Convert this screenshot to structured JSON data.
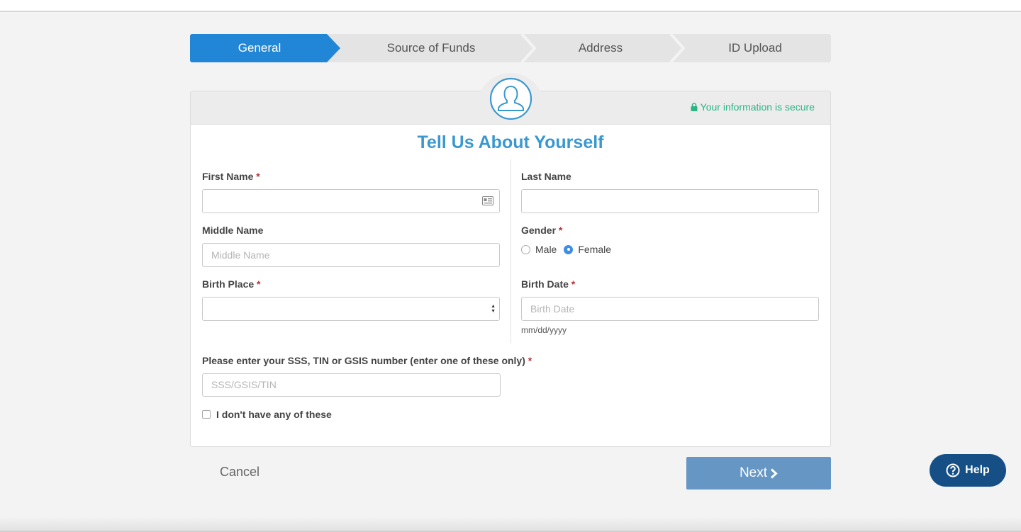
{
  "stepper": {
    "steps": [
      {
        "label": "General",
        "active": true
      },
      {
        "label": "Source of Funds",
        "active": false
      },
      {
        "label": "Address",
        "active": false
      },
      {
        "label": "ID Upload",
        "active": false
      }
    ]
  },
  "card": {
    "secure_text": "Your information is secure",
    "title": "Tell Us About Yourself"
  },
  "form": {
    "first_name": {
      "label": "First Name",
      "required_mark": "*",
      "value": ""
    },
    "last_name": {
      "label": "Last Name",
      "value": ""
    },
    "middle_name": {
      "label": "Middle Name",
      "placeholder": "Middle Name"
    },
    "gender": {
      "label": "Gender",
      "required_mark": "*",
      "options": [
        "Male",
        "Female"
      ],
      "selected": "Female"
    },
    "birth_place": {
      "label": "Birth Place",
      "required_mark": "*",
      "value": ""
    },
    "birth_date": {
      "label": "Birth Date",
      "required_mark": "*",
      "placeholder": "Birth Date",
      "hint": "mm/dd/yyyy"
    },
    "id_number": {
      "label": "Please enter your SSS, TIN or GSIS number (enter one of these only)",
      "required_mark": "*",
      "placeholder": "SSS/GSIS/TIN"
    },
    "no_id_checkbox": {
      "label": "I don't have any of these",
      "checked": false
    }
  },
  "actions": {
    "cancel_label": "Cancel",
    "next_label": "Next",
    "help_label": "Help"
  },
  "colors": {
    "accent": "#2186d6",
    "title": "#3a98d0",
    "secure": "#2bb585",
    "next_button": "#6596c4",
    "help_button": "#154f85",
    "required": "#b4343a"
  },
  "icons": {
    "avatar": "user-circle-icon",
    "secure": "lock-icon",
    "first_name_field": "id-card-icon",
    "select": "select-arrows-icon",
    "next": "chevron-right-icon",
    "help": "question-circle-icon"
  }
}
